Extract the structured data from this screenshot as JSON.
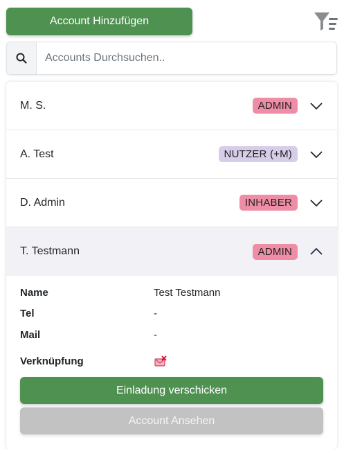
{
  "toolbar": {
    "add_label": "Account Hinzufügen",
    "filter_icon": "filter-list-icon"
  },
  "search": {
    "placeholder": "Accounts Durchsuchen..",
    "value": "",
    "icon": "search-icon"
  },
  "accounts": [
    {
      "name": "M. S.",
      "role": "ADMIN",
      "role_color": "#ef8da6",
      "expanded": false
    },
    {
      "name": "A. Test",
      "role": "NUTZER (+M)",
      "role_color": "#d6cde8",
      "expanded": false
    },
    {
      "name": "D. Admin",
      "role": "INHABER",
      "role_color": "#ef8da6",
      "expanded": false
    },
    {
      "name": "T. Testmann",
      "role": "ADMIN",
      "role_color": "#ef8da6",
      "expanded": true
    }
  ],
  "details": {
    "name_label": "Name",
    "name_value": "Test Testmann",
    "tel_label": "Tel",
    "tel_value": "-",
    "mail_label": "Mail",
    "mail_value": "-",
    "link_label": "Verknüpfung",
    "link_icon": "unlinked-icon",
    "invite_label": "Einladung verschicken",
    "view_label": "Account Ansehen"
  },
  "colors": {
    "primary": "#4f9150",
    "badge_red": "#ef8da6",
    "badge_purple": "#d6cde8",
    "disabled": "#c2c2c2",
    "expanded_bg": "#f1f1f6"
  }
}
